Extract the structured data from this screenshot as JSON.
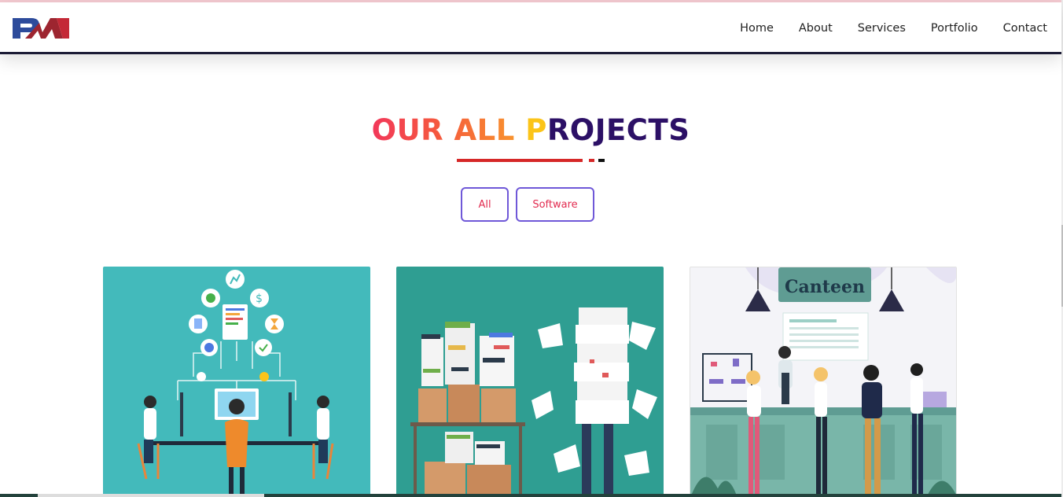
{
  "header": {
    "logo_text": "PM",
    "nav": [
      "Home",
      "About",
      "Services",
      "Portfolio",
      "Contact"
    ]
  },
  "section": {
    "title_part1": "OUR ALL ",
    "title_p": "P",
    "title_part2": "ROJECTS",
    "colors": {
      "red": "#f2385a",
      "orange": "#f99b2c",
      "yellow": "#fbc419",
      "purple": "#2c1066",
      "underline_red": "#d62828",
      "underline_dark": "#111111"
    }
  },
  "filters": [
    "All",
    "Software"
  ],
  "cards": [
    {
      "name": "team-dashboard-illustration"
    },
    {
      "name": "paper-stacks-illustration"
    },
    {
      "name": "canteen-illustration",
      "sign": "Canteen"
    }
  ]
}
